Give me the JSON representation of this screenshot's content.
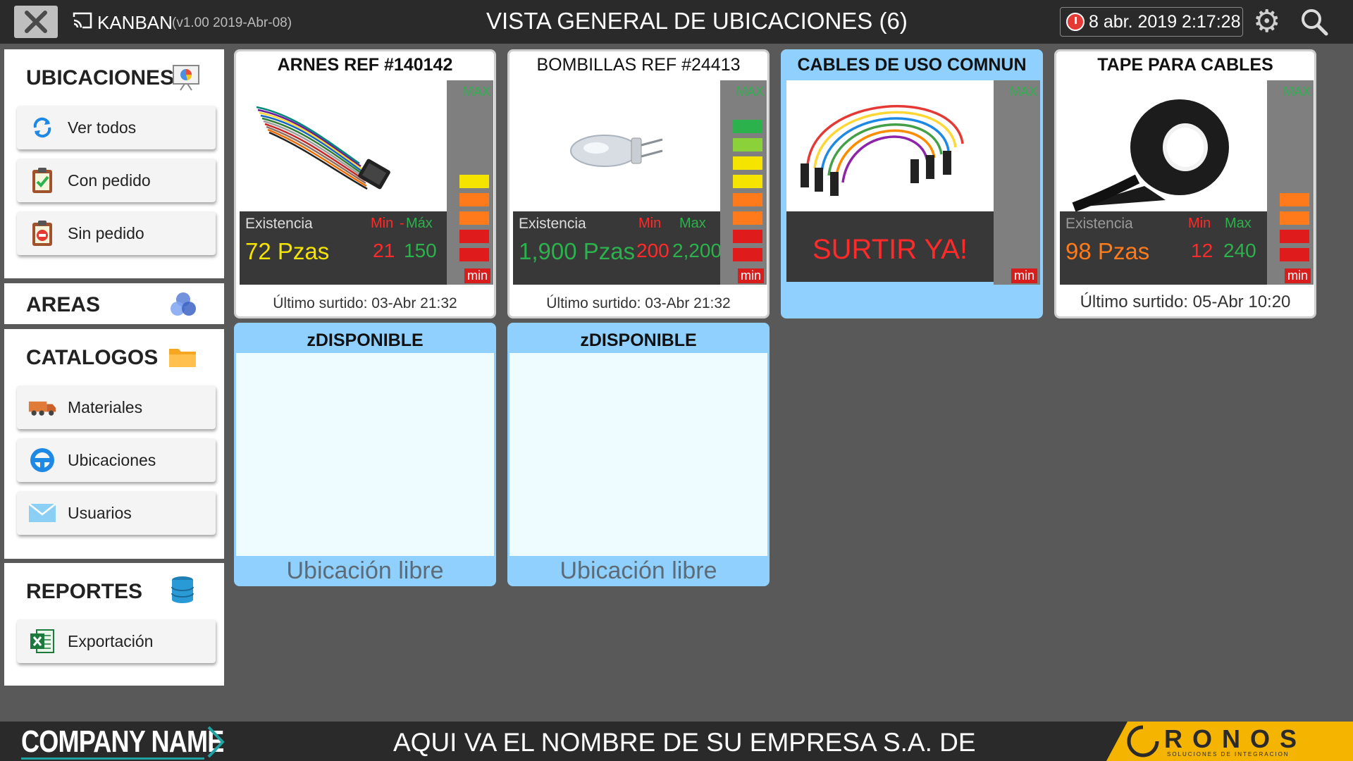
{
  "app": {
    "name": "KANBAN",
    "version": "(v1.00 2019-Abr-08)",
    "title": "VISTA GENERAL DE UBICACIONES (6)",
    "datetime": "8 abr. 2019 2:17:28"
  },
  "sidebar": {
    "ubicaciones": {
      "title": "UBICACIONES",
      "items": [
        {
          "label": "Ver todos",
          "icon": "refresh-icon"
        },
        {
          "label": "Con pedido",
          "icon": "clipboard-check-icon"
        },
        {
          "label": "Sin pedido",
          "icon": "clipboard-minus-icon"
        }
      ]
    },
    "areas": {
      "title": "AREAS",
      "icon": "venn-circles-icon"
    },
    "catalogos": {
      "title": "CATALOGOS",
      "items": [
        {
          "label": "Materiales",
          "icon": "truck-icon"
        },
        {
          "label": "Ubicaciones",
          "icon": "steering-wheel-icon"
        },
        {
          "label": "Usuarios",
          "icon": "envelope-icon"
        }
      ]
    },
    "reportes": {
      "title": "REPORTES",
      "items": [
        {
          "label": "Exportación",
          "icon": "excel-icon"
        }
      ]
    }
  },
  "cards": [
    {
      "title": "ARNES REF #140142",
      "existence_label": "Existencia",
      "existence_value": "72 Pzas",
      "min_label": "Min",
      "sep": "-",
      "max_label": "Máx",
      "min_value": "21",
      "max_value": "150",
      "last_supply": "Último surtido: 03-Abr 21:32",
      "meter_max": "MAX",
      "meter_min": "min"
    },
    {
      "title": "BOMBILLAS REF #24413",
      "existence_label": "Existencia",
      "existence_value": "1,900 Pzas",
      "min_label": "Min",
      "max_label": "Max",
      "min_value": "200",
      "max_value": "2,200",
      "last_supply": "Último surtido: 03-Abr 21:32",
      "meter_max": "MAX",
      "meter_min": "min"
    },
    {
      "title": "CABLES DE USO COMNUN",
      "alert": "SURTIR YA!",
      "meter_max": "MAX",
      "meter_min": "min"
    },
    {
      "title": "TAPE PARA CABLES",
      "existence_label": "Existencia",
      "existence_value": "98 Pzas",
      "min_label": "Min",
      "max_label": "Max",
      "min_value": "12",
      "max_value": "240",
      "last_supply": "Último surtido: 05-Abr 10:20",
      "meter_max": "MAX",
      "meter_min": "min"
    }
  ],
  "free_slots": [
    {
      "title": "zDISPONIBLE",
      "footer": "Ubicación libre"
    },
    {
      "title": "zDISPONIBLE",
      "footer": "Ubicación libre"
    }
  ],
  "footer": {
    "company_logo": "COMPANY NAME",
    "company_text": "AQUI VA EL NOMBRE DE SU EMPRESA S.A. DE",
    "brand": "RONOS",
    "brand_tagline": "SOLUCIONES DE INTEGRACION"
  },
  "colors": {
    "accent_blue": "#8fd0ff",
    "alert_red": "#ff2a2a",
    "ok_green": "#2bb24c",
    "warn_yellow": "#f5e400",
    "warn_orange": "#ff7a1a"
  }
}
